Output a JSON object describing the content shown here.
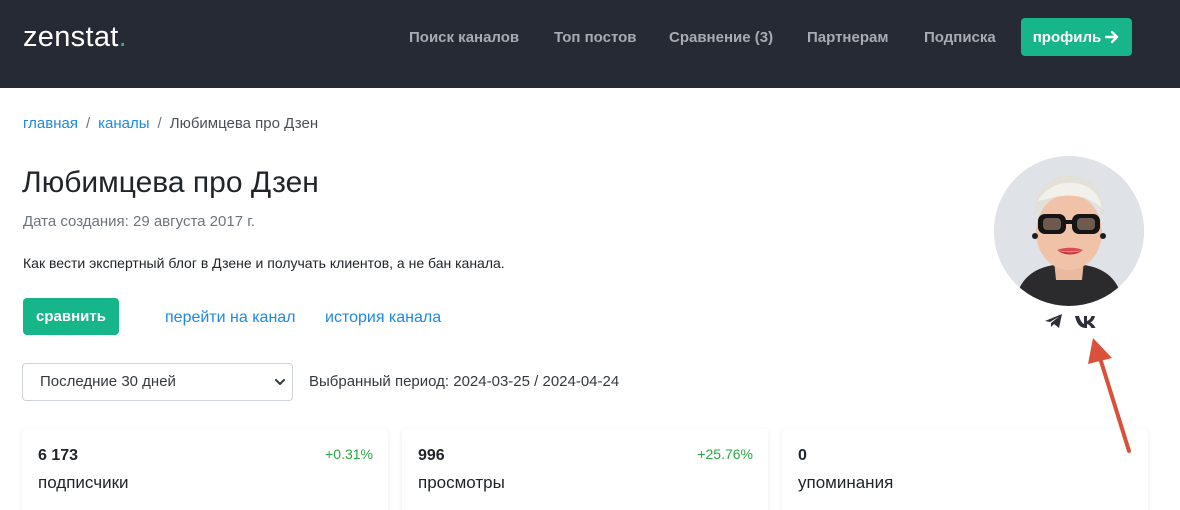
{
  "header": {
    "logo_text": "zenstat",
    "logo_dot": ".",
    "nav": [
      "Поиск каналов",
      "Топ постов",
      "Сравнение (3)",
      "Партнерам",
      "Подписка"
    ],
    "profile_label": "профиль",
    "profile_icon": "arrow-right-icon"
  },
  "breadcrumb": {
    "home": "главная",
    "channels": "каналы",
    "current": "Любимцева про Дзен",
    "separator": "/"
  },
  "channel": {
    "title": "Любимцева про Дзен",
    "created": "Дата создания: 29 августа 2017 г.",
    "description": "Как вести экспертный блог в Дзене и получать клиентов, а не бан канала."
  },
  "actions": {
    "compare": "сравнить",
    "goto": "перейти на канал",
    "history": "история канала"
  },
  "social": [
    "telegram-icon",
    "vk-icon"
  ],
  "period": {
    "selected": "Последние 30 дней",
    "label": "Выбранный период: 2024-03-25 / 2024-04-24"
  },
  "stats": [
    {
      "value": "6 173",
      "label": "подписчики",
      "delta": "+0.31%"
    },
    {
      "value": "996",
      "label": "просмотры",
      "delta": "+25.76%"
    },
    {
      "value": "0",
      "label": "упоминания",
      "delta": ""
    }
  ],
  "colors": {
    "header_bg": "#262a34",
    "accent": "#17b58a",
    "link": "#1e88e5",
    "positive": "#28a745",
    "annotation_arrow": "#d9513a"
  }
}
